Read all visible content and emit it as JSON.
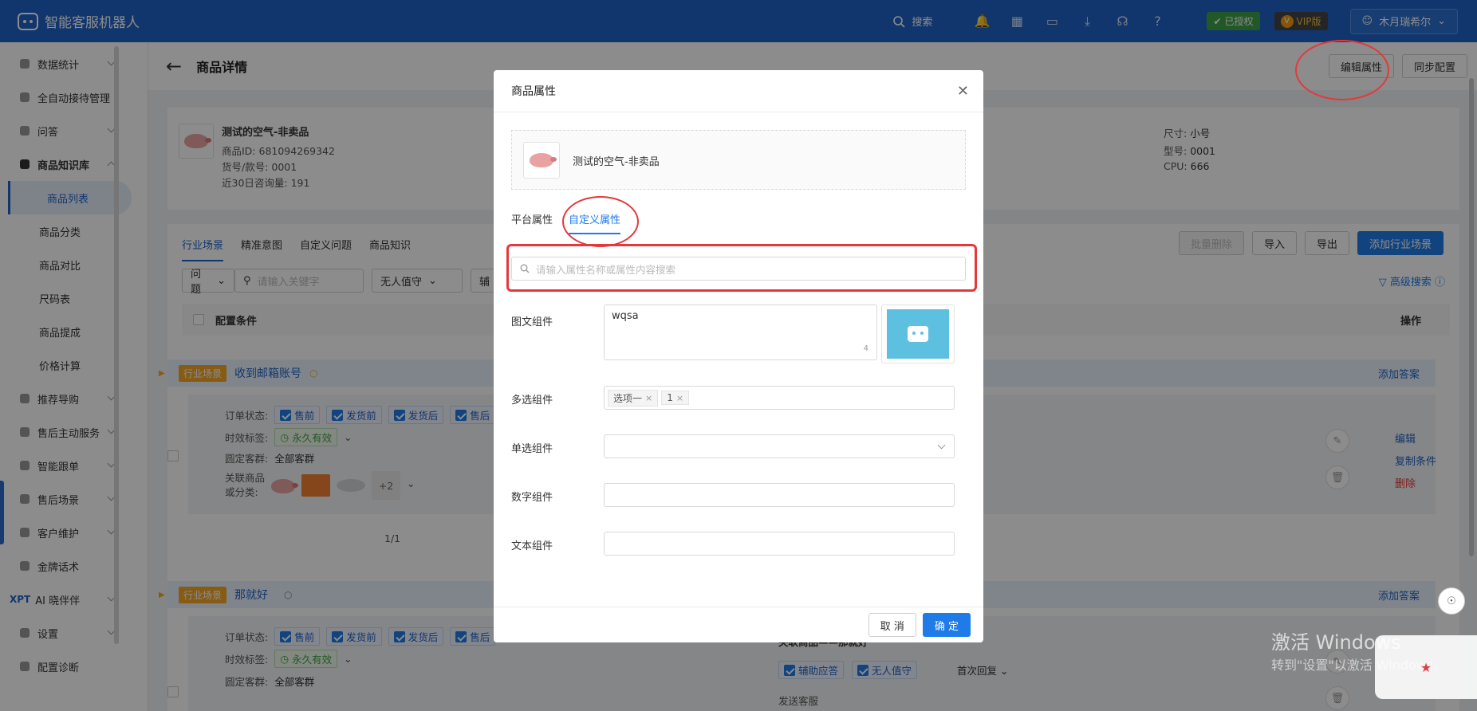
{
  "app": {
    "title": "智能客服机器人"
  },
  "topbar": {
    "search_label": "搜索",
    "auth_badge": "已授权",
    "vip_badge": "VIP版",
    "user_name": "木月瑞希尔"
  },
  "sidebar": {
    "items": [
      {
        "label": "数据统计"
      },
      {
        "label": "全自动接待管理"
      },
      {
        "label": "问答"
      },
      {
        "label": "商品知识库"
      },
      {
        "label": "商品列表"
      },
      {
        "label": "商品分类"
      },
      {
        "label": "商品对比"
      },
      {
        "label": "尺码表"
      },
      {
        "label": "商品提成"
      },
      {
        "label": "价格计算"
      },
      {
        "label": "推荐导购"
      },
      {
        "label": "售后主动服务"
      },
      {
        "label": "智能跟单"
      },
      {
        "label": "售后场景"
      },
      {
        "label": "客户维护"
      },
      {
        "label": "金牌话术"
      },
      {
        "label": "AI 晓伴伴",
        "prefix": "XPT"
      },
      {
        "label": "设置"
      },
      {
        "label": "配置诊断"
      }
    ]
  },
  "page": {
    "title": "商品详情",
    "edit_attr_btn": "编辑属性",
    "sync_btn": "同步配置"
  },
  "product": {
    "name": "测试的空气-非卖品",
    "id_line": "商品ID: 681094269342",
    "sku_line": "货号/款号: 0001",
    "consult_line": "近30日咨询量: 191",
    "attrs": [
      {
        "label": "尺寸:",
        "value": "小号"
      },
      {
        "label": "型号:",
        "value": "0001"
      },
      {
        "label": "CPU:",
        "value": "666"
      }
    ]
  },
  "tabs": {
    "items": [
      "行业场景",
      "精准意图",
      "自定义问题",
      "商品知识"
    ],
    "batch_delete": "批量删除",
    "import": "导入",
    "export": "导出",
    "add_scene": "添加行业场景"
  },
  "filters": {
    "type": "问题",
    "keyword_placeholder": "请输入关键字",
    "mode": "无人值守",
    "extra": "辅",
    "advanced": "高级搜索"
  },
  "table": {
    "col_condition": "配置条件",
    "col_action": "操作"
  },
  "scenes": [
    {
      "tag": "行业场景",
      "name": "收到邮箱账号",
      "add_answer": "添加答案",
      "order_status_label": "订单状态:",
      "order_status": [
        "售前",
        "发货前",
        "发货后",
        "售后"
      ],
      "time_label": "时效标签:",
      "time_value": "永久有效",
      "group_label": "圆定客群:",
      "group_value": "全部客群",
      "related_label": "关联商品",
      "related_label2": "或分类:",
      "related_more": "+2",
      "page": "1/1",
      "ops": [
        "编辑",
        "复制条件",
        "删除"
      ]
    },
    {
      "tag": "行业场景",
      "name": "那就好",
      "add_answer": "添加答案",
      "order_status_label": "订单状态:",
      "order_status": [
        "售前",
        "发货前",
        "发货后",
        "售后"
      ],
      "time_label": "时效标签:",
      "time_value": "永久有效",
      "group_label": "圆定客群:",
      "group_value": "全部客群",
      "related_answer": "关联商品——那就好",
      "answer_assist": "辅助应答",
      "answer_unattended": "无人值守",
      "first_reply": "首次回复",
      "send_group": "发送客服"
    }
  ],
  "modal": {
    "title": "商品属性",
    "product_name": "测试的空气-非卖品",
    "tab_platform": "平台属性",
    "tab_custom": "自定义属性",
    "search_placeholder": "请输入属性名称或属性内容搜索",
    "fields": {
      "rich_label": "图文组件",
      "rich_value": "wqsa",
      "rich_count": "4",
      "multi_label": "多选组件",
      "multi_tags": [
        "选项一",
        "1"
      ],
      "single_label": "单选组件",
      "number_label": "数字组件",
      "text_label": "文本组件"
    },
    "cancel": "取 消",
    "confirm": "确 定"
  },
  "watermark": {
    "line1": "激活 Windows",
    "line2": "转到\"设置\"以激活 Windows。"
  },
  "colors": {
    "primary": "#1f63c6",
    "accent": "#1f7be8",
    "highlight_red": "#e5383b",
    "tag_orange": "#f5a623"
  }
}
